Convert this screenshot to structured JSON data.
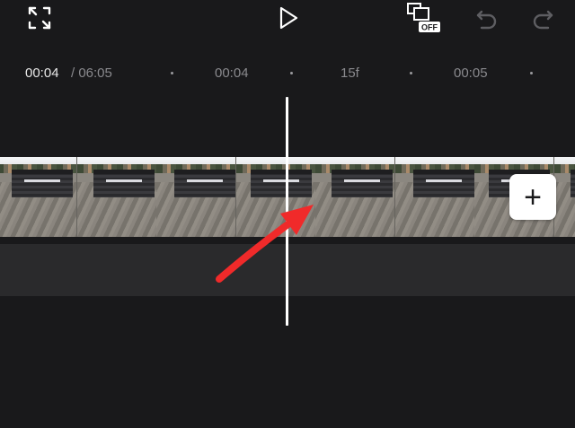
{
  "toolbar": {
    "fullscreen_icon": "fullscreen-icon",
    "play_icon": "play-icon",
    "keyframe_toggle_label": "OFF",
    "undo_icon": "undo-icon",
    "redo_icon": "redo-icon"
  },
  "timeline": {
    "current_time": "00:04",
    "total_time": "/ 06:05",
    "ticks": [
      "00:04",
      "15f",
      "00:05"
    ]
  },
  "track": {
    "add_button_label": "+",
    "frame_count": 8
  },
  "annotation": {
    "arrow_color": "#f02a2a"
  },
  "colors": {
    "background": "#19191b",
    "audio_track": "#2a2a2c",
    "playhead": "#ffffff",
    "muted_text": "#8a8a8e"
  }
}
